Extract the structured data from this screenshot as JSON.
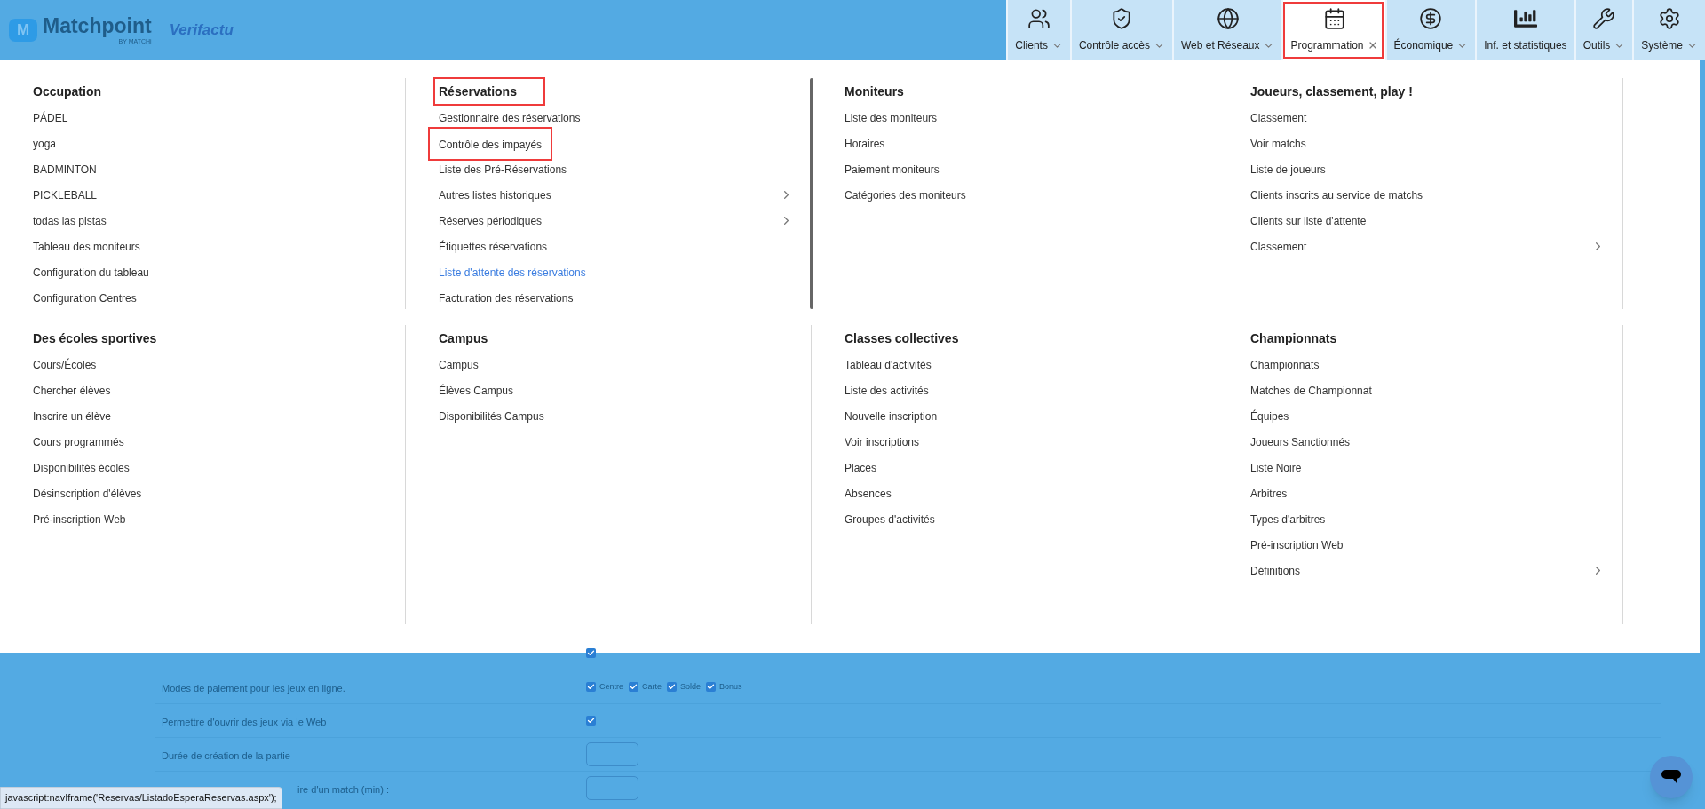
{
  "header": {
    "brand": "Matchpoint",
    "brand_mark": "M",
    "tagline": "BY MATCHi",
    "partner": "Verifactu"
  },
  "nav": [
    {
      "label": "Clients",
      "selected": false,
      "dropdown": true,
      "boxed": false
    },
    {
      "label": "Contrôle accès",
      "selected": false,
      "dropdown": true,
      "boxed": false
    },
    {
      "label": "Web et Réseaux",
      "selected": false,
      "dropdown": true,
      "boxed": false
    },
    {
      "label": "Programmation",
      "selected": true,
      "boxed": true
    },
    {
      "label": "Économique",
      "selected": false,
      "dropdown": true,
      "boxed": false
    },
    {
      "label": "Inf. et statistiques",
      "selected": false,
      "dropdown": false,
      "boxed": false
    },
    {
      "label": "Outils",
      "selected": false,
      "dropdown": true,
      "boxed": false
    },
    {
      "label": "Système",
      "selected": false,
      "dropdown": true,
      "boxed": false
    }
  ],
  "menu": [
    [
      {
        "title": "Occupation",
        "boxed": false,
        "items": [
          {
            "label": "PÁDEL",
            "submenu": false,
            "hovered": false,
            "boxed": false
          },
          {
            "label": "yoga",
            "submenu": false,
            "hovered": false,
            "boxed": false
          },
          {
            "label": "BADMINTON",
            "submenu": false,
            "hovered": false,
            "boxed": false
          },
          {
            "label": "PICKLEBALL",
            "submenu": false,
            "hovered": false,
            "boxed": false
          },
          {
            "label": "todas las pistas",
            "submenu": false,
            "hovered": false,
            "boxed": false
          },
          {
            "label": "Tableau des moniteurs",
            "submenu": false,
            "hovered": false,
            "boxed": false
          },
          {
            "label": "Configuration du tableau",
            "submenu": false,
            "hovered": false,
            "boxed": false
          },
          {
            "label": "Configuration Centres",
            "submenu": false,
            "hovered": false,
            "boxed": false
          }
        ]
      },
      {
        "title": "Réservations",
        "boxed": true,
        "scrollbar": true,
        "items": [
          {
            "label": "Gestionnaire des réservations",
            "submenu": false,
            "hovered": false,
            "boxed": false
          },
          {
            "label": "Contrôle des impayés",
            "submenu": false,
            "hovered": false,
            "boxed": true
          },
          {
            "label": "Liste des Pré-Réservations",
            "submenu": false,
            "hovered": false,
            "boxed": false
          },
          {
            "label": "Autres listes historiques",
            "submenu": true,
            "hovered": false,
            "boxed": false
          },
          {
            "label": "Réserves périodiques",
            "submenu": true,
            "hovered": false,
            "boxed": false
          },
          {
            "label": "Étiquettes réservations",
            "submenu": false,
            "hovered": false,
            "boxed": false
          },
          {
            "label": "Liste d'attente des réservations",
            "submenu": false,
            "hovered": true,
            "boxed": false
          },
          {
            "label": "Facturation des réservations",
            "submenu": false,
            "hovered": false,
            "boxed": false
          }
        ]
      },
      {
        "title": "Moniteurs",
        "boxed": false,
        "items": [
          {
            "label": "Liste des moniteurs",
            "submenu": false,
            "hovered": false,
            "boxed": false
          },
          {
            "label": "Horaires",
            "submenu": false,
            "hovered": false,
            "boxed": false
          },
          {
            "label": "Paiement moniteurs",
            "submenu": false,
            "hovered": false,
            "boxed": false
          },
          {
            "label": "Catégories des moniteurs",
            "submenu": false,
            "hovered": false,
            "boxed": false
          }
        ]
      },
      {
        "title": "Joueurs, classement, play !",
        "boxed": false,
        "items": [
          {
            "label": "Classement",
            "submenu": false,
            "hovered": false,
            "boxed": false
          },
          {
            "label": "Voir matchs",
            "submenu": false,
            "hovered": false,
            "boxed": false
          },
          {
            "label": "Liste de joueurs",
            "submenu": false,
            "hovered": false,
            "boxed": false
          },
          {
            "label": "Clients inscrits au service de matchs",
            "submenu": false,
            "hovered": false,
            "boxed": false
          },
          {
            "label": "Clients sur liste d'attente",
            "submenu": false,
            "hovered": false,
            "boxed": false
          },
          {
            "label": "Classement",
            "submenu": true,
            "hovered": false,
            "boxed": false
          }
        ]
      }
    ],
    [
      {
        "title": "Des écoles sportives",
        "boxed": false,
        "items": [
          {
            "label": "Cours/Écoles",
            "submenu": false,
            "hovered": false,
            "boxed": false
          },
          {
            "label": "Chercher élèves",
            "submenu": false,
            "hovered": false,
            "boxed": false
          },
          {
            "label": "Inscrire un élève",
            "submenu": false,
            "hovered": false,
            "boxed": false
          },
          {
            "label": "Cours programmés",
            "submenu": false,
            "hovered": false,
            "boxed": false
          },
          {
            "label": "Disponibilités écoles",
            "submenu": false,
            "hovered": false,
            "boxed": false
          },
          {
            "label": "Désinscription d'élèves",
            "submenu": false,
            "hovered": false,
            "boxed": false
          },
          {
            "label": "Pré-inscription Web",
            "submenu": false,
            "hovered": false,
            "boxed": false
          }
        ]
      },
      {
        "title": "Campus",
        "boxed": false,
        "items": [
          {
            "label": "Campus",
            "submenu": false,
            "hovered": false,
            "boxed": false
          },
          {
            "label": "Élèves Campus",
            "submenu": false,
            "hovered": false,
            "boxed": false
          },
          {
            "label": "Disponibilités Campus",
            "submenu": false,
            "hovered": false,
            "boxed": false
          }
        ]
      },
      {
        "title": "Classes collectives",
        "boxed": false,
        "items": [
          {
            "label": "Tableau d'activités",
            "submenu": false,
            "hovered": false,
            "boxed": false
          },
          {
            "label": "Liste des activités",
            "submenu": false,
            "hovered": false,
            "boxed": false
          },
          {
            "label": "Nouvelle inscription",
            "submenu": false,
            "hovered": false,
            "boxed": false
          },
          {
            "label": "Voir inscriptions",
            "submenu": false,
            "hovered": false,
            "boxed": false
          },
          {
            "label": "Places",
            "submenu": false,
            "hovered": false,
            "boxed": false
          },
          {
            "label": "Absences",
            "submenu": false,
            "hovered": false,
            "boxed": false
          },
          {
            "label": "Groupes d'activités",
            "submenu": false,
            "hovered": false,
            "boxed": false
          }
        ]
      },
      {
        "title": "Championnats",
        "boxed": false,
        "items": [
          {
            "label": "Championnats",
            "submenu": false,
            "hovered": false,
            "boxed": false
          },
          {
            "label": "Matches de Championnat",
            "submenu": false,
            "hovered": false,
            "boxed": false
          },
          {
            "label": "Équipes",
            "submenu": false,
            "hovered": false,
            "boxed": false
          },
          {
            "label": "Joueurs Sanctionnés",
            "submenu": false,
            "hovered": false,
            "boxed": false
          },
          {
            "label": "Liste Noire",
            "submenu": false,
            "hovered": false,
            "boxed": false
          },
          {
            "label": "Arbitres",
            "submenu": false,
            "hovered": false,
            "boxed": false
          },
          {
            "label": "Types d'arbitres",
            "submenu": false,
            "hovered": false,
            "boxed": false
          },
          {
            "label": "Pré-inscription Web",
            "submenu": false,
            "hovered": false,
            "boxed": false
          },
          {
            "label": "Définitions",
            "submenu": true,
            "hovered": false,
            "boxed": false
          }
        ]
      }
    ]
  ],
  "settings": [
    {
      "kind": "checkbox",
      "checked": true
    },
    {
      "kind": "checkgroup",
      "label": "Modes de paiement pour les jeux en ligne.",
      "options": [
        {
          "label": "Centre",
          "checked": true
        },
        {
          "label": "Carte",
          "checked": true
        },
        {
          "label": "Solde",
          "checked": true
        },
        {
          "label": "Bonus",
          "checked": true
        }
      ]
    },
    {
      "kind": "checkbox",
      "label": "Permettre d'ouvrir des jeux via le Web",
      "checked": true
    },
    {
      "kind": "input",
      "label": "Durée de création de la partie"
    },
    {
      "kind": "input",
      "label": "ire d'un match (min) :",
      "covered": true
    }
  ],
  "status_bar": "javascript:navIframe('Reservas/ListadoEsperaReservas.aspx');"
}
